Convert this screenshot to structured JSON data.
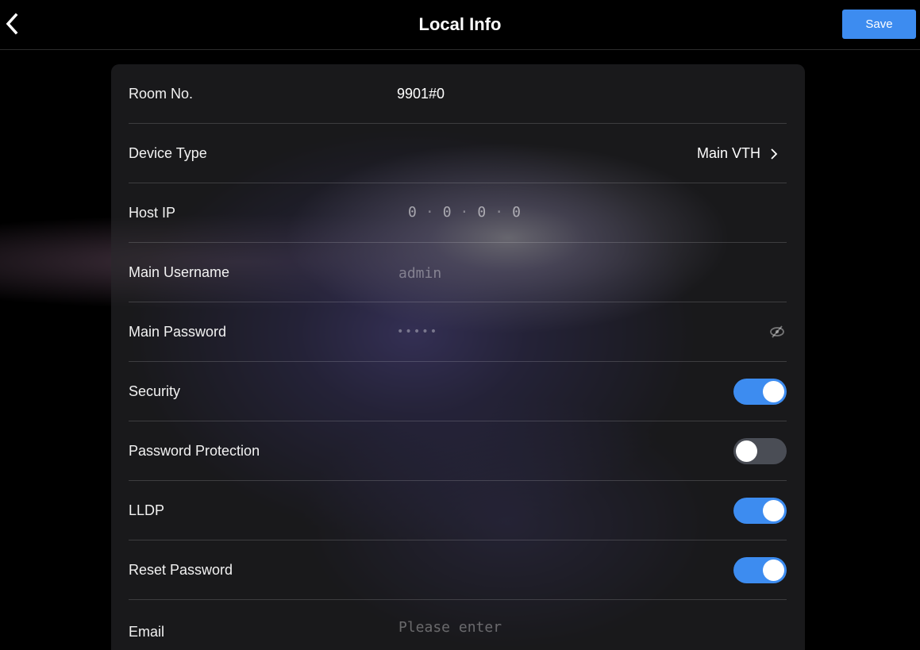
{
  "header": {
    "title": "Local Info",
    "save_label": "Save",
    "back_icon": "chevron-left-icon"
  },
  "rows": {
    "room_no": {
      "label": "Room No.",
      "value": "9901#0"
    },
    "device_type": {
      "label": "Device Type",
      "value": "Main VTH",
      "icon": "chevron-right-icon"
    },
    "host_ip": {
      "label": "Host IP",
      "octets": [
        "0",
        "0",
        "0",
        "0"
      ],
      "separator": "·"
    },
    "main_username": {
      "label": "Main Username",
      "placeholder": "admin"
    },
    "main_password": {
      "label": "Main Password",
      "masked_value": "•••••",
      "icon": "eye-hidden-icon"
    },
    "security": {
      "label": "Security",
      "enabled": true
    },
    "password_protection": {
      "label": "Password Protection",
      "enabled": false
    },
    "lldp": {
      "label": "LLDP",
      "enabled": true
    },
    "reset_password": {
      "label": "Reset Password",
      "enabled": true
    },
    "email": {
      "label": "Email",
      "placeholder": "Please enter"
    }
  },
  "colors": {
    "accent": "#3d8cf0",
    "toggle_off": "#4a4d55",
    "background": "#000000"
  }
}
